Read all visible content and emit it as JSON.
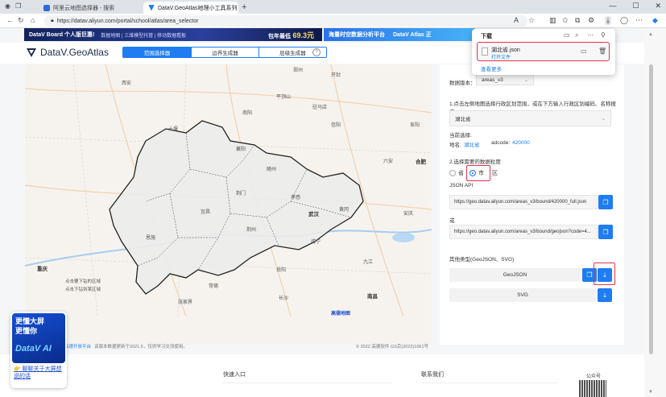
{
  "browser": {
    "tabs": [
      {
        "title": "阿里云地图选择器 - 搜索",
        "favicon_color": "#2e6bd8"
      },
      {
        "title": "DataV.GeoAtlas地理小工具系列",
        "favicon_color": "#1f7cf2"
      }
    ],
    "new_tab_symbol": "+",
    "url": "https://datav.aliyun.com/portal/school/atlas/area_selector",
    "window_controls": [
      "—",
      "☐",
      "✕"
    ]
  },
  "banners": {
    "left_title": "DataV Board 个人版巨惠!",
    "left_sub": "数据地图 | 三维模型托管 | 移动数据看板",
    "left_tag": "包年最低",
    "left_price": "69.3元",
    "right_title": "海量时空数据分析平台",
    "right_brand": "DataV Atlas 正"
  },
  "header": {
    "logo_text": "DataV.GeoAtlas",
    "tabs": [
      "范围选择器",
      "边界生成器",
      "层级生成器"
    ],
    "help": "?"
  },
  "map": {
    "cities": [
      {
        "name": "西安"
      },
      {
        "name": "郑州"
      },
      {
        "name": "开封"
      },
      {
        "name": "平顶山"
      },
      {
        "name": "南阳"
      },
      {
        "name": "信阳"
      },
      {
        "name": "驻马店"
      },
      {
        "name": "阜阳"
      },
      {
        "name": "六安"
      },
      {
        "name": "合肥"
      },
      {
        "name": "安庆"
      },
      {
        "name": "十堰"
      },
      {
        "name": "襄阳"
      },
      {
        "name": "随州"
      },
      {
        "name": "孝感"
      },
      {
        "name": "武汉"
      },
      {
        "name": "黄冈"
      },
      {
        "name": "荆门"
      },
      {
        "name": "宜昌"
      },
      {
        "name": "荆州"
      },
      {
        "name": "恩施"
      },
      {
        "name": "咸宁"
      },
      {
        "name": "九江"
      },
      {
        "name": "岳阳"
      },
      {
        "name": "常德"
      },
      {
        "name": "重庆"
      },
      {
        "name": "长沙"
      },
      {
        "name": "南昌"
      },
      {
        "name": "张家界"
      },
      {
        "name": "南昌"
      }
    ],
    "legend": [
      "点击要下钻的区域",
      "点击下钻到某区域"
    ],
    "footer_link": "高德开放平台",
    "footer_note": "该版本数据更新于2021.5，仅供学习交流使用。",
    "copyright": "© 2022 高德软件 GS京(2022)1061号",
    "amap_logo": "高德地图"
  },
  "panel": {
    "version_label": "数据版本：",
    "version_value": "areas_v3",
    "step1": "1.点击左侧地图选择行政区划范围，或在下方输入行政区划编码、名称搜索",
    "region_input": "湖北省",
    "current_label": "当前选择:",
    "current_name_label": "地名:",
    "current_name": "湖北省",
    "adcode_label": "adcode:",
    "adcode": "420000",
    "step2": "2.选择需要的数据粒度",
    "granularity": [
      {
        "label": "省",
        "selected": false
      },
      {
        "label": "市",
        "selected": true
      },
      {
        "label": "区",
        "selected": false
      }
    ],
    "json_api_label": "JSON API",
    "api_url_1": "https://geo.datav.aliyun.com/areas_v3/bound/420000_full.json",
    "or_label": "或",
    "api_url_2": "https://geo.datav.aliyun.com/areas_v3/bound/geojson?code=4...",
    "other_types_label": "其他类型(GeoJSON、SVG)",
    "geojson_label": "GeoJSON",
    "svg_label": "SVG",
    "accent": "#1f7cf2",
    "highlight": "#e8334a"
  },
  "footer": {
    "quick_entry": "快速入口",
    "contact": "联系我们",
    "qr_label": "公众号"
  },
  "ai_card": {
    "line1": "更懂大屏",
    "line2": "更懂你",
    "tag": "DataV AI",
    "cta": "👉 聊聊关于大屏想说的话"
  },
  "download": {
    "title": "下载",
    "file_name": "湖北省.json",
    "open_label": "打开文件",
    "more": "查看更多"
  }
}
